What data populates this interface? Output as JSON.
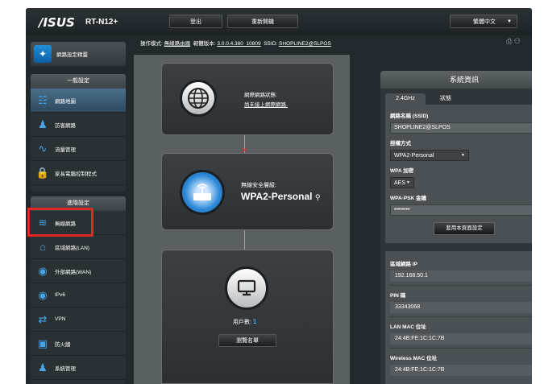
{
  "header": {
    "brand": "/ISUS",
    "model": "RT-N12+",
    "logout_label": "登出",
    "reboot_label": "重新開機",
    "language": "繁體中文",
    "language_arrow": "▼"
  },
  "status": {
    "mode_label": "操作模式:",
    "mode_value": "無線路由器",
    "firmware_label": "韌體版本:",
    "firmware_value": "3.0.0.4.380_10809",
    "ssid_label": "SSID:",
    "ssid_value": "SHOPLINE2@SLPOS"
  },
  "sidebar": {
    "wizard_label": "網路設定精靈",
    "general_title": "一般設定",
    "general_items": [
      {
        "label": "網路地圖",
        "icon": "network-map-icon"
      },
      {
        "label": "訪客網路",
        "icon": "guest-network-icon"
      },
      {
        "label": "流量管理",
        "icon": "traffic-manager-icon"
      },
      {
        "label": "家長電腦控制程式",
        "icon": "parental-control-icon"
      }
    ],
    "advanced_title": "進階設定",
    "advanced_items": [
      {
        "label": "無線網路",
        "icon": "wifi-icon"
      },
      {
        "label": "區域網路(LAN)",
        "icon": "home-lan-icon"
      },
      {
        "label": "外部網路(WAN)",
        "icon": "globe-wan-icon"
      },
      {
        "label": "IPv6",
        "icon": "ipv6-icon"
      },
      {
        "label": "VPN",
        "icon": "vpn-icon"
      },
      {
        "label": "防火牆",
        "icon": "firewall-icon"
      },
      {
        "label": "系統管理",
        "icon": "admin-icon"
      }
    ]
  },
  "map": {
    "internet_status_label": "網際網路狀態:",
    "internet_status_value": "尚未接上網際網路.",
    "security_label": "無線安全層級:",
    "security_value": "WPA2-Personal",
    "clients_label": "用戶數:",
    "clients_value": "1",
    "view_list_label": "瀏覽名單"
  },
  "sysinfo": {
    "title": "系統資訊",
    "tab_24": "2.4GHz",
    "tab_status": "狀態",
    "ssid_label": "網路名稱 (SSID)",
    "ssid_value": "SHOPLINE2@SLPOS",
    "auth_label": "授權方式",
    "auth_value": "WPA2-Personal",
    "wpa_enc_label": "WPA 加密",
    "wpa_enc_value": "AES",
    "psk_label": "WPA-PSK 金鑰",
    "psk_value": "••••••••",
    "apply_label": "套用本頁面設定",
    "lan_ip_label": "區域網路 IP",
    "lan_ip_value": "192.168.50.1",
    "pin_label": "PIN 碼",
    "pin_value": "33343068",
    "lan_mac_label": "LAN MAC 位址",
    "lan_mac_value": "24:4B:FE:1C:1C:7B",
    "wl_mac_label": "Wireless MAC 位址",
    "wl_mac_value": "24:4B:FE:1C:1C:7B"
  }
}
